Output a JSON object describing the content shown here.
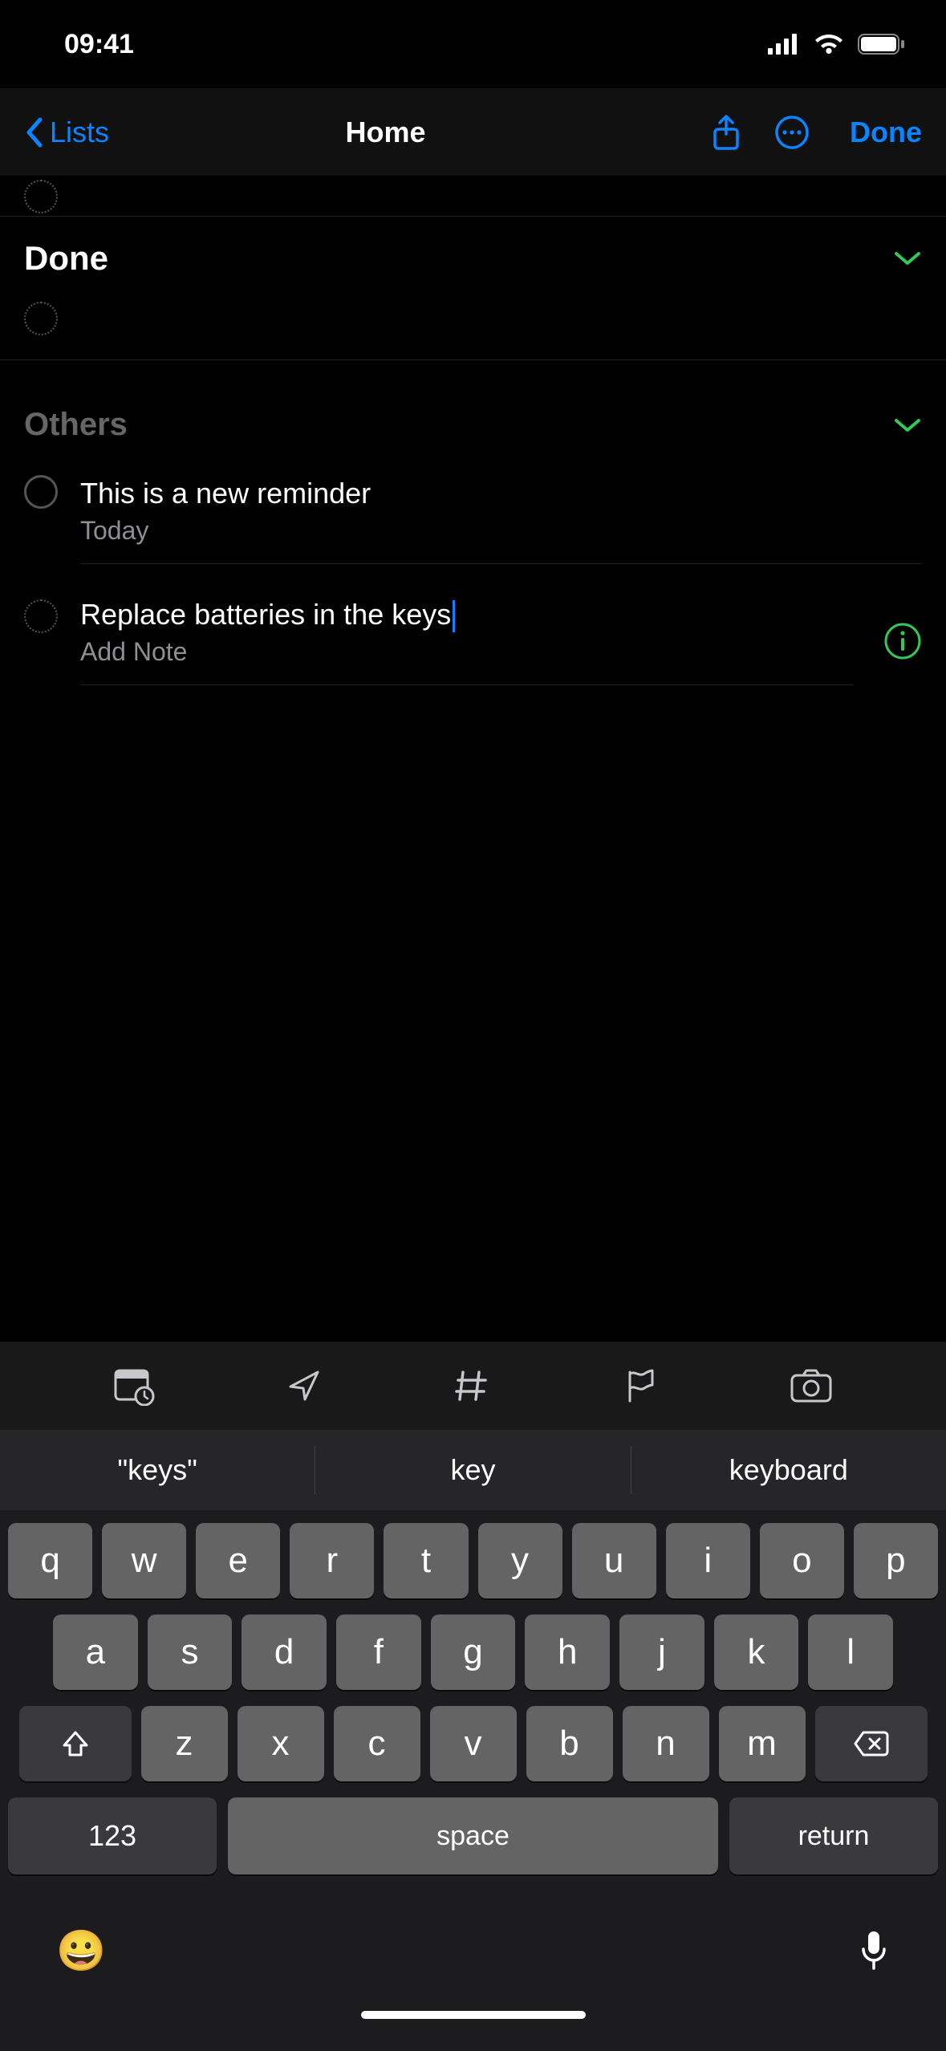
{
  "status": {
    "time": "09:41"
  },
  "nav": {
    "back_label": "Lists",
    "title": "Home",
    "done_label": "Done"
  },
  "sections": {
    "done": {
      "title": "Done"
    },
    "others": {
      "title": "Others",
      "items": [
        {
          "title": "This is a new reminder",
          "sub": "Today"
        },
        {
          "title": "Replace batteries in the keys",
          "sub": "Add Note",
          "editing": true
        }
      ]
    }
  },
  "suggestions": [
    "\"keys\"",
    "key",
    "keyboard"
  ],
  "keyboard": {
    "row1": [
      "q",
      "w",
      "e",
      "r",
      "t",
      "y",
      "u",
      "i",
      "o",
      "p"
    ],
    "row2": [
      "a",
      "s",
      "d",
      "f",
      "g",
      "h",
      "j",
      "k",
      "l"
    ],
    "row3": [
      "z",
      "x",
      "c",
      "v",
      "b",
      "n",
      "m"
    ],
    "num_label": "123",
    "space_label": "space",
    "return_label": "return"
  }
}
